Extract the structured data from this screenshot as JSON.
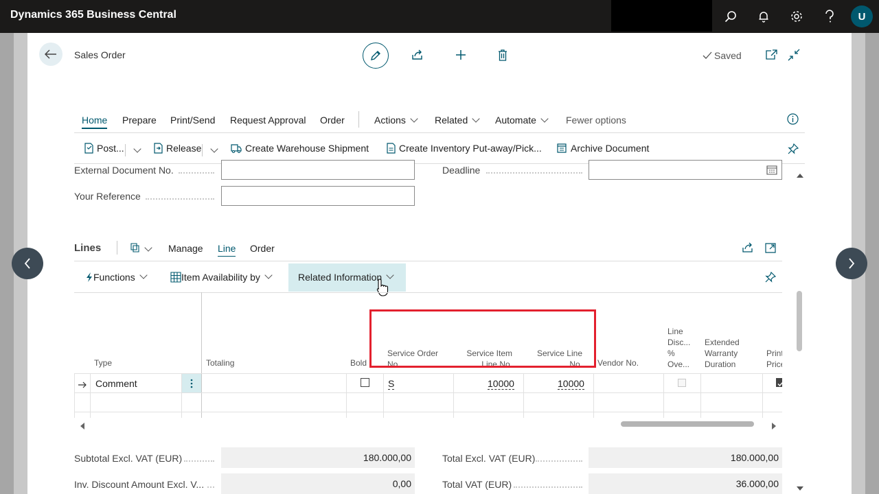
{
  "app": {
    "title": "Dynamics 365 Business Central",
    "user_initial": "U"
  },
  "header": {
    "page_title": "Sales Order",
    "saved_label": "Saved"
  },
  "menu": {
    "items": [
      "Home",
      "Prepare",
      "Print/Send",
      "Request Approval",
      "Order",
      "Actions",
      "Related",
      "Automate",
      "Fewer options"
    ]
  },
  "actions": {
    "post": "Post...",
    "release": "Release",
    "create_warehouse_shipment": "Create Warehouse Shipment",
    "create_inventory_putaway": "Create Inventory Put-away/Pick...",
    "archive_document": "Archive Document"
  },
  "fields": {
    "external_document_no": {
      "label": "External Document No.",
      "value": ""
    },
    "deadline": {
      "label": "Deadline",
      "value": ""
    },
    "your_reference": {
      "label": "Your Reference",
      "value": ""
    }
  },
  "lines": {
    "title": "Lines",
    "tabs": [
      "Manage",
      "Line",
      "Order"
    ],
    "sub_actions": {
      "functions": "Functions",
      "item_availability": "Item Availability by",
      "related_information": "Related Information"
    },
    "columns": {
      "type": "Type",
      "totaling": "Totaling",
      "bold": "Bold",
      "service_order_no": [
        "Service Order",
        "No."
      ],
      "service_item_line_no": [
        "Service Item",
        "Line No."
      ],
      "service_line_no": [
        "Service Line",
        "No."
      ],
      "vendor_no": "Vendor No.",
      "line_disc": [
        "Line",
        "Disc...",
        "%",
        "Ove..."
      ],
      "extended_warranty": [
        "Extended",
        "Warranty",
        "Duration"
      ],
      "print_price": [
        "Print",
        "Price"
      ]
    },
    "rows": [
      {
        "type": "Comment",
        "service_order_no": "S",
        "service_item_line_no": "10000",
        "service_line_no": "10000"
      }
    ]
  },
  "totals": {
    "subtotal_excl_vat": {
      "label": "Subtotal Excl. VAT (EUR)",
      "value": "180.000,00"
    },
    "inv_discount": {
      "label": "Inv. Discount Amount Excl. V...",
      "value": "0,00"
    },
    "total_excl_vat": {
      "label": "Total Excl. VAT (EUR)",
      "value": "180.000,00"
    },
    "total_vat": {
      "label": "Total VAT (EUR)",
      "value": "36.000,00"
    }
  },
  "colors": {
    "accent": "#00586e",
    "highlight": "#e3202e",
    "topbar": "#1b1a19"
  }
}
